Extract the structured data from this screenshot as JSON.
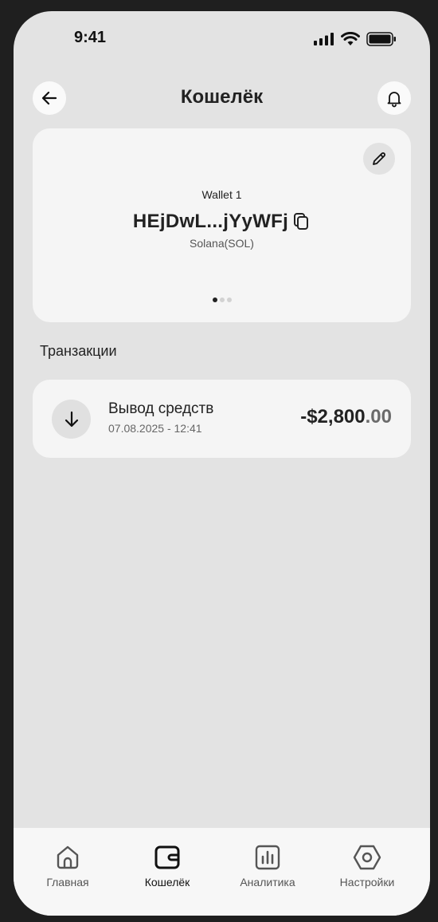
{
  "status": {
    "time": "9:41"
  },
  "header": {
    "title": "Кошелёк",
    "back_icon": "arrow-left-icon",
    "bell_icon": "bell-icon"
  },
  "wallet": {
    "name": "Wallet 1",
    "address": "HEjDwL...jYyWFj",
    "network": "Solana(SOL)",
    "pages": 3,
    "active_page": 1
  },
  "transactions": {
    "title": "Транзакции",
    "items": [
      {
        "title": "Вывод средств",
        "date": "07.08.2025 - 12:41",
        "amount_main": "-$2,800",
        "amount_cents": ".00",
        "icon": "arrow-down-icon"
      }
    ]
  },
  "tabbar": {
    "items": [
      {
        "label": "Главная",
        "icon": "home-icon"
      },
      {
        "label": "Кошелёк",
        "icon": "wallet-icon",
        "active": true
      },
      {
        "label": "Аналитика",
        "icon": "chart-icon"
      },
      {
        "label": "Настройки",
        "icon": "settings-icon"
      }
    ]
  }
}
